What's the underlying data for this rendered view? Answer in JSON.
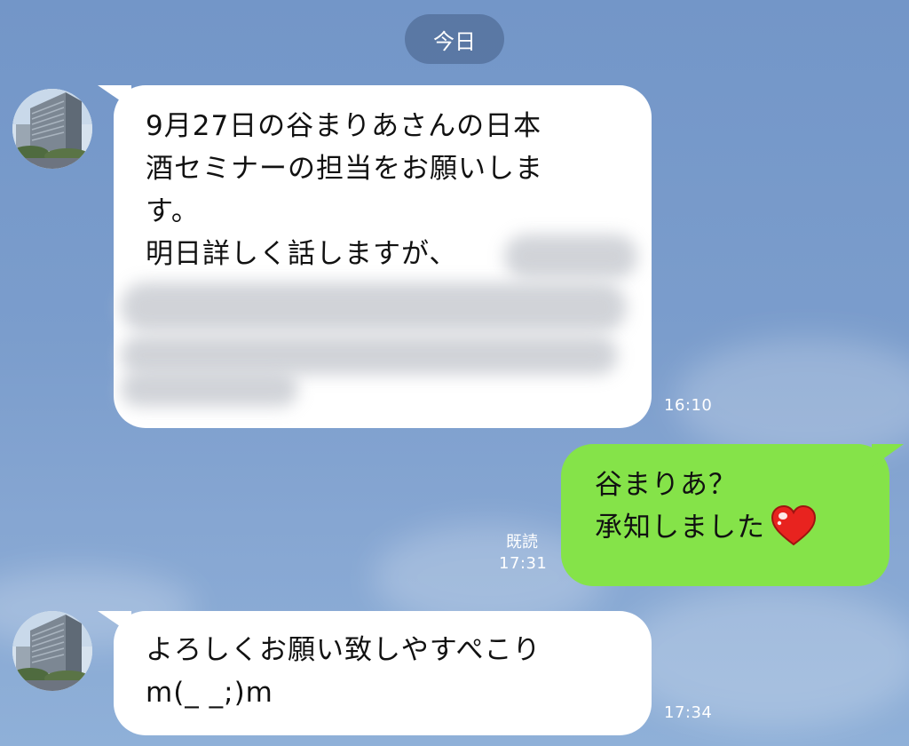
{
  "date_divider": "今日",
  "messages": [
    {
      "direction": "incoming",
      "lines": [
        "9月27日の谷まりあさんの日本",
        "酒セミナーの担当をお願いしま",
        "す。",
        "明日詳しく話しますが、"
      ],
      "time": "16:10"
    },
    {
      "direction": "outgoing",
      "lines": [
        "谷まりあ？",
        "承知しました"
      ],
      "read_label": "既読",
      "time": "17:31",
      "emoji": "heart-icon"
    },
    {
      "direction": "incoming",
      "lines": [
        "よろしくお願い致しやすぺこり",
        "m(_ _;)m"
      ],
      "time": "17:34"
    }
  ],
  "colors": {
    "background": "#7b9dcc",
    "incoming_bubble": "#ffffff",
    "outgoing_bubble": "#85e349",
    "heart": "#e8231f"
  }
}
